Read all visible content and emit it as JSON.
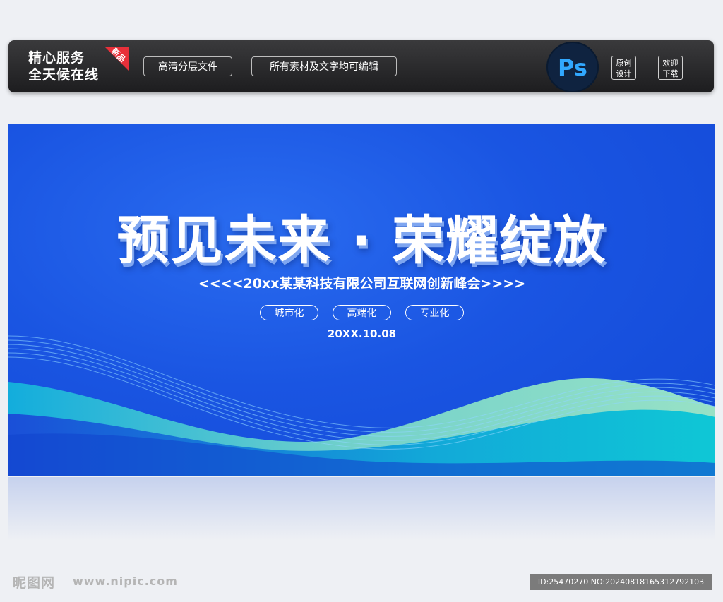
{
  "toolbar": {
    "service_line1": "精心服务",
    "service_line2": "全天候在线",
    "new_badge": "新品",
    "tag1": "高清分层文件",
    "tag2": "所有素材及文字均可编辑",
    "ps_label": "Ps",
    "original_line1": "原创",
    "original_line2": "设计",
    "download_line1": "欢迎",
    "download_line2": "下载"
  },
  "banner": {
    "title": "预见未来 · 荣耀绽放",
    "subtitle": "<<<<20xx某某科技有限公司互联网创新峰会>>>>",
    "pills": [
      "城市化",
      "高端化",
      "专业化"
    ],
    "date": "20XX.10.08"
  },
  "footer": {
    "logo": "昵图网",
    "url": "www.nipic.com",
    "id_text": "ID:25470270 NO:20240818165312792103"
  },
  "colors": {
    "banner_blue": "#1a55e2",
    "wave_teal": "#12c3d8",
    "wave_green": "#9ef0c0",
    "ps_blue": "#31a8ff",
    "badge_red": "#e8303a"
  }
}
